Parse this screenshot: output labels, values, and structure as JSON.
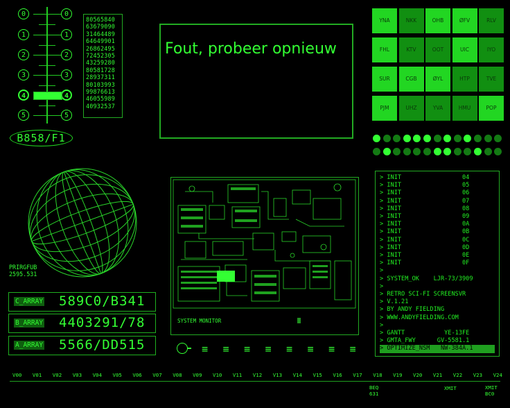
{
  "slider": {
    "levels_left": [
      "0",
      "1",
      "2",
      "3",
      "4",
      "5"
    ],
    "levels_right": [
      "0",
      "1",
      "2",
      "3",
      "4",
      "5"
    ],
    "selected_level": 4
  },
  "numbers": [
    "80565840",
    "63679090",
    "31464489",
    "64649901",
    "26862495",
    "72452305",
    "43259280",
    "80581728",
    "28937311",
    "80103993",
    "99876613",
    "46055989",
    "40932537"
  ],
  "badge": "B858/F1",
  "message": "Fout, probeer opnieuw",
  "keypad": [
    {
      "label": "YNA",
      "state": "on"
    },
    {
      "label": "NKK",
      "state": "dim"
    },
    {
      "label": "OHB",
      "state": "on"
    },
    {
      "label": "ØFV",
      "state": "on"
    },
    {
      "label": "RLV",
      "state": "dim"
    },
    {
      "label": "FHL",
      "state": "on"
    },
    {
      "label": "KTV",
      "state": "dim"
    },
    {
      "label": "OOT",
      "state": "dim"
    },
    {
      "label": "UIC",
      "state": "on"
    },
    {
      "label": "IYO",
      "state": "dim"
    },
    {
      "label": "SUR",
      "state": "on"
    },
    {
      "label": "CGB",
      "state": "on"
    },
    {
      "label": "ØYL",
      "state": "on"
    },
    {
      "label": "HTP",
      "state": "dim"
    },
    {
      "label": "TVE",
      "state": "dim"
    },
    {
      "label": "PJM",
      "state": "on"
    },
    {
      "label": "UHZ",
      "state": "dim"
    },
    {
      "label": "YVA",
      "state": "dim"
    },
    {
      "label": "HMU",
      "state": "dim"
    },
    {
      "label": "POP",
      "state": "on"
    }
  ],
  "led_rows": [
    [
      1,
      0,
      0,
      1,
      1,
      1,
      0,
      1,
      0,
      1,
      0,
      0,
      0
    ],
    [
      0,
      1,
      0,
      0,
      0,
      0,
      1,
      1,
      0,
      0,
      1,
      0,
      0
    ]
  ],
  "globe_label": [
    "PRIRGFUB",
    "2595.531"
  ],
  "board_label": "SYSTEM MONITOR",
  "terminal": [
    "> INIT                 04",
    "> INIT                 05",
    "> INIT                 06",
    "> INIT                 07",
    "> INIT                 08",
    "> INIT                 09",
    "> INIT                 0A",
    "> INIT                 0B",
    "> INIT                 0C",
    "> INIT                 0D",
    "> INIT                 0E",
    "> INIT                 0F",
    ">",
    "> SYSTEM_OK    LJR-73/3909",
    ">",
    "> RETRO SCI-FI SCREENSVR",
    "> V.1.21",
    "> BY ANDY FIELDING",
    "> WWW.ANDYFIELDING.COM",
    ">",
    "> GANTT           YE-13FE",
    "> GMTA_FWY      GV-5581.1",
    "> OPTIMIZE_NSM   NW-384A.1"
  ],
  "arrays": [
    {
      "label": "C_ARRAY",
      "value": "589C0/B341"
    },
    {
      "label": "B_ARRAY",
      "value": "4403291/78"
    },
    {
      "label": "A_ARRAY",
      "value": "5566/DD515"
    }
  ],
  "eq_glyphs": [
    "≡",
    "≡",
    "≡",
    "≡",
    "≡",
    "≡",
    "≡",
    "≡"
  ],
  "v_labels": [
    "V00",
    "V01",
    "V02",
    "V03",
    "V04",
    "V05",
    "V06",
    "V07",
    "V08",
    "V09",
    "V10",
    "V11",
    "V12",
    "V13",
    "V14",
    "V15",
    "V16",
    "V17",
    "V18",
    "V19",
    "V20",
    "V21",
    "V22",
    "V23",
    "V24"
  ],
  "footer": {
    "beq": [
      "BEQ",
      "631"
    ],
    "xmit1": "XMIT",
    "xmit2": [
      "XMIT",
      "BC0"
    ]
  },
  "colors": {
    "bright": "#33ff33",
    "dim": "#1a8a1a",
    "key_on": "#22d622",
    "key_dim": "#118f11",
    "bg": "#000000"
  }
}
